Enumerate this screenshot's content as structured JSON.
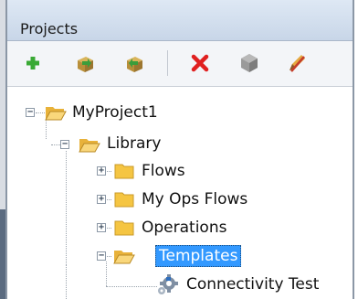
{
  "panel": {
    "title": "Projects"
  },
  "toolbar": {
    "buttons": [
      {
        "name": "add",
        "icon": "plus-icon"
      },
      {
        "name": "import",
        "icon": "import-box-icon"
      },
      {
        "name": "export",
        "icon": "export-box-icon"
      },
      {
        "name": "delete",
        "icon": "red-x-icon"
      },
      {
        "name": "disabled-action",
        "icon": "gray-cube-icon"
      },
      {
        "name": "edit",
        "icon": "pencil-slash-icon"
      }
    ]
  },
  "tree": {
    "project": {
      "label": "MyProject1",
      "expanded": true
    },
    "library": {
      "label": "Library",
      "expanded": true
    },
    "folders": [
      {
        "label": "Flows",
        "expanded": false
      },
      {
        "label": "My Ops Flows",
        "expanded": false
      },
      {
        "label": "Operations",
        "expanded": false
      },
      {
        "label": "Templates",
        "expanded": true,
        "selected": true
      }
    ],
    "template_item": {
      "label": "Connectivity Test"
    }
  },
  "colors": {
    "selection": "#3399ff",
    "folder": "#f5c542",
    "delete": "#e02020"
  }
}
